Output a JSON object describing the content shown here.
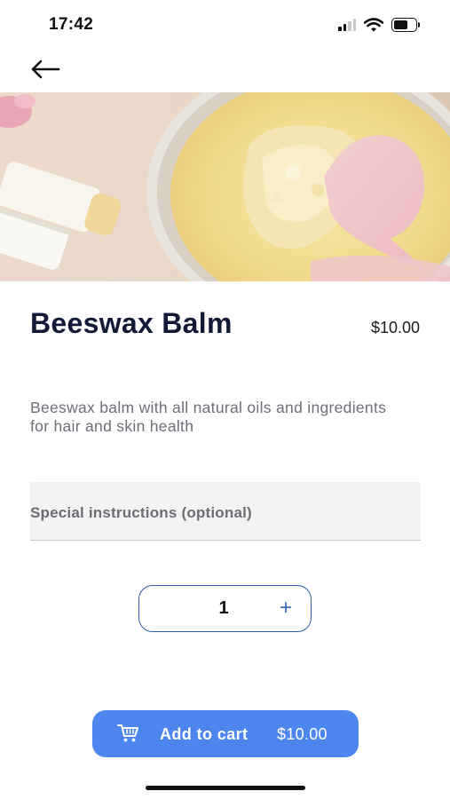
{
  "status_bar": {
    "time": "17:42"
  },
  "product": {
    "title": "Beeswax Balm",
    "price": "$10.00",
    "description": "Beeswax balm with all natural oils and ingredients for hair and skin health"
  },
  "instructions": {
    "placeholder": "Special instructions (optional)"
  },
  "quantity": {
    "value": "1",
    "increment_label": "+"
  },
  "cart_button": {
    "label": "Add to cart",
    "price": "$10.00"
  },
  "colors": {
    "accent": "#4d86ee",
    "stepper_border": "#2d5da8",
    "title_text": "#121a38",
    "muted_text": "#6d7078",
    "field_background": "#f3f3f3"
  },
  "icons": {
    "back": "arrow-left-icon",
    "cart": "cart-icon",
    "signal": "signal-icon",
    "wifi": "wifi-icon",
    "battery": "battery-icon"
  }
}
